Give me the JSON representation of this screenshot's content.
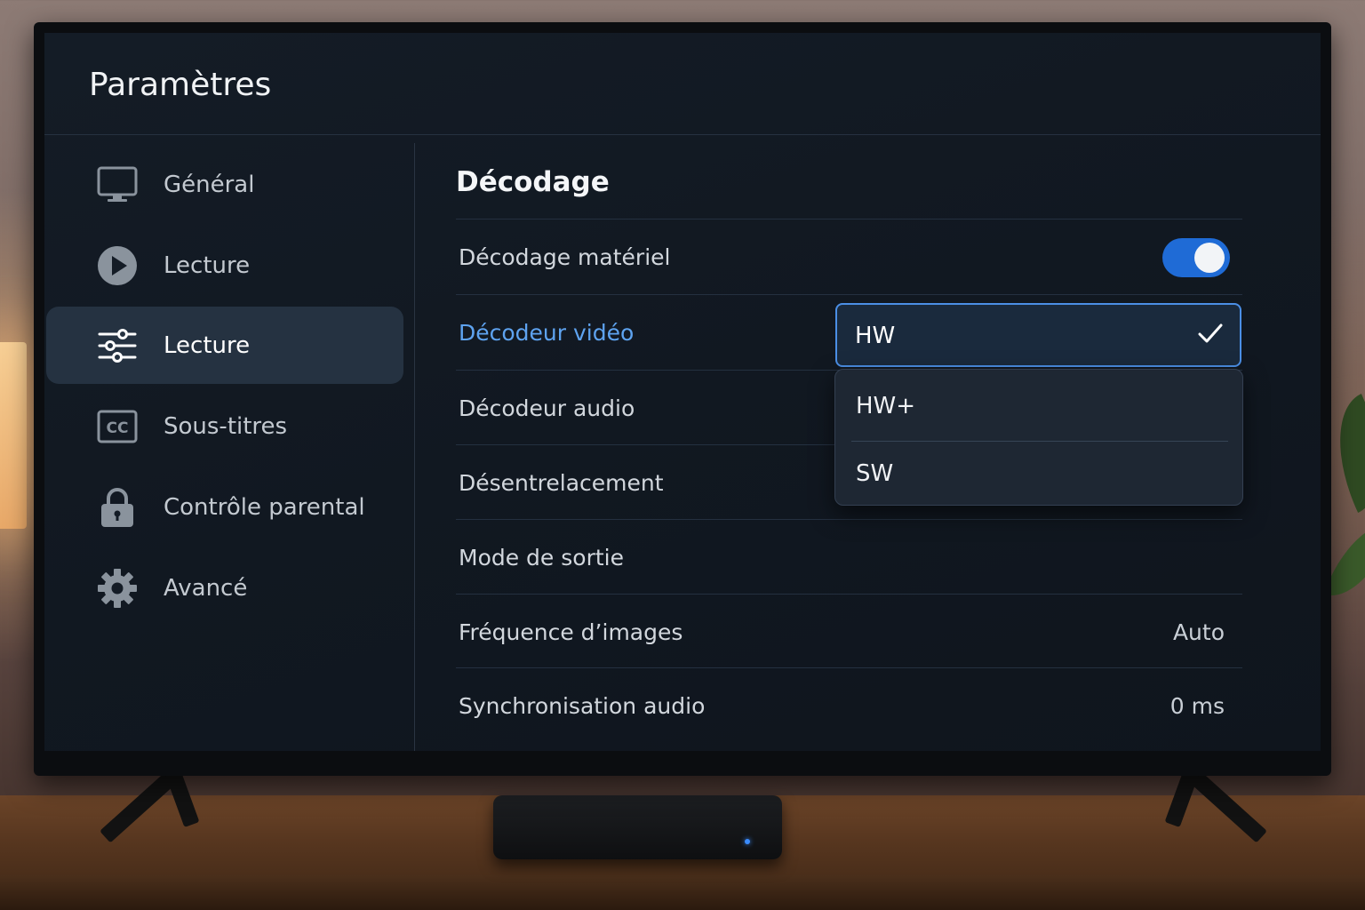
{
  "app": {
    "title": "Paramètres"
  },
  "sidebar": {
    "items": [
      {
        "label": "Général",
        "icon": "monitor-icon",
        "active": false
      },
      {
        "label": "Lecture",
        "icon": "play-icon",
        "active": false
      },
      {
        "label": "Lecture",
        "icon": "sliders-icon",
        "active": true
      },
      {
        "label": "Sous-titres",
        "icon": "cc-icon",
        "active": false
      },
      {
        "label": "Contrôle parental",
        "icon": "lock-icon",
        "active": false
      },
      {
        "label": "Avancé",
        "icon": "gear-icon",
        "active": false
      }
    ]
  },
  "main": {
    "section_title": "Décodage",
    "rows": [
      {
        "label": "Décodage matériel",
        "control": "toggle",
        "toggle_on": true
      },
      {
        "label": "Décodeur vidéo",
        "control": "select",
        "focused": true
      },
      {
        "label": "Décodeur audio"
      },
      {
        "label": "Désentrelacement"
      },
      {
        "label": "Mode de sortie"
      },
      {
        "label": "Fréquence d’images",
        "value": "Auto"
      },
      {
        "label": "Synchronisation audio",
        "value": "0 ms"
      }
    ],
    "video_decoder_select": {
      "selected": "HW",
      "options": [
        "HW+",
        "SW"
      ]
    }
  },
  "colors": {
    "accent": "#1f6bd6",
    "focus_text": "#5ea3f0",
    "screen_bg": "#121a23"
  }
}
